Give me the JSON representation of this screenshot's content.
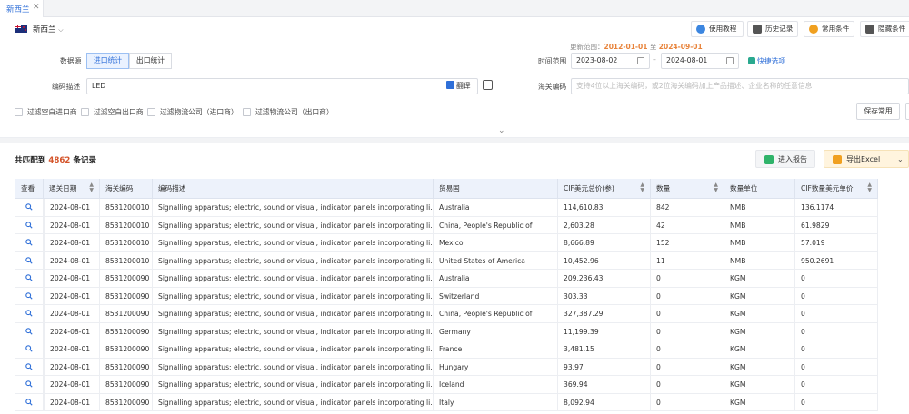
{
  "tabs": [
    {
      "label": "新西兰",
      "close": "✕"
    }
  ],
  "country": {
    "flag": "new-zealand-flag",
    "name": "新西兰",
    "chevron": "⌵"
  },
  "toolbar": {
    "tutorial": "使用教程",
    "history": "历史记录",
    "conditions": "常用条件",
    "hide_conditions": "隐藏条件"
  },
  "update_range": {
    "prefix": "更新范围：",
    "from": "2012-01-01",
    "sep": " 至 ",
    "to": "2024-09-01"
  },
  "filters": {
    "source_label": "数据源",
    "source_options": [
      "进口统计",
      "出口统计"
    ],
    "source_selected": "进口统计",
    "time_label": "时间范围",
    "date_from": "2023-08-02",
    "date_sep": "–",
    "date_to": "2024-08-01",
    "quick_option": "快捷选项",
    "desc_label": "编码描述",
    "desc_value": "LED",
    "translate": "翻译",
    "hs_label": "海关编码",
    "hs_placeholder": "支持4位以上海关编码，或2位海关编码加上产品描述、企业名称的任意信息",
    "checkboxes": [
      "过滤空白进口商",
      "过滤空白出口商",
      "过滤物流公司（进口商）",
      "过滤物流公司（出口商）"
    ],
    "save": "保存常用",
    "collapse": "⌄"
  },
  "results": {
    "prefix": "共匹配到",
    "count": "4862",
    "suffix": "条记录",
    "report_btn": "进入报告",
    "export_btn": "导出Excel",
    "export_chevron": "⌄"
  },
  "table": {
    "headers": [
      "查看",
      "通关日期",
      "海关编码",
      "编码描述",
      "贸易国",
      "CIF美元总价(参)",
      "数量",
      "数量单位",
      "CIF数量美元单价"
    ],
    "rows": [
      [
        "2024-08-01",
        "8531200010",
        "Signalling apparatus; electric, sound or visual, indicator panels incorporating li...",
        "Australia",
        "114,610.83",
        "842",
        "NMB",
        "136.1174"
      ],
      [
        "2024-08-01",
        "8531200010",
        "Signalling apparatus; electric, sound or visual, indicator panels incorporating li...",
        "China, People's Republic of",
        "2,603.28",
        "42",
        "NMB",
        "61.9829"
      ],
      [
        "2024-08-01",
        "8531200010",
        "Signalling apparatus; electric, sound or visual, indicator panels incorporating li...",
        "Mexico",
        "8,666.89",
        "152",
        "NMB",
        "57.019"
      ],
      [
        "2024-08-01",
        "8531200010",
        "Signalling apparatus; electric, sound or visual, indicator panels incorporating li...",
        "United States of America",
        "10,452.96",
        "11",
        "NMB",
        "950.2691"
      ],
      [
        "2024-08-01",
        "8531200090",
        "Signalling apparatus; electric, sound or visual, indicator panels incorporating li...",
        "Australia",
        "209,236.43",
        "0",
        "KGM",
        "0"
      ],
      [
        "2024-08-01",
        "8531200090",
        "Signalling apparatus; electric, sound or visual, indicator panels incorporating li...",
        "Switzerland",
        "303.33",
        "0",
        "KGM",
        "0"
      ],
      [
        "2024-08-01",
        "8531200090",
        "Signalling apparatus; electric, sound or visual, indicator panels incorporating li...",
        "China, People's Republic of",
        "327,387.29",
        "0",
        "KGM",
        "0"
      ],
      [
        "2024-08-01",
        "8531200090",
        "Signalling apparatus; electric, sound or visual, indicator panels incorporating li...",
        "Germany",
        "11,199.39",
        "0",
        "KGM",
        "0"
      ],
      [
        "2024-08-01",
        "8531200090",
        "Signalling apparatus; electric, sound or visual, indicator panels incorporating li...",
        "France",
        "3,481.15",
        "0",
        "KGM",
        "0"
      ],
      [
        "2024-08-01",
        "8531200090",
        "Signalling apparatus; electric, sound or visual, indicator panels incorporating li...",
        "Hungary",
        "93.97",
        "0",
        "KGM",
        "0"
      ],
      [
        "2024-08-01",
        "8531200090",
        "Signalling apparatus; electric, sound or visual, indicator panels incorporating li...",
        "Iceland",
        "369.94",
        "0",
        "KGM",
        "0"
      ],
      [
        "2024-08-01",
        "8531200090",
        "Signalling apparatus; electric, sound or visual, indicator panels incorporating li...",
        "Italy",
        "8,092.94",
        "0",
        "KGM",
        "0"
      ]
    ]
  },
  "colors": {
    "accent": "#2f6fd8",
    "highlight": "#e8833a",
    "count": "#d4542a",
    "header_bg": "#edf2fb"
  }
}
